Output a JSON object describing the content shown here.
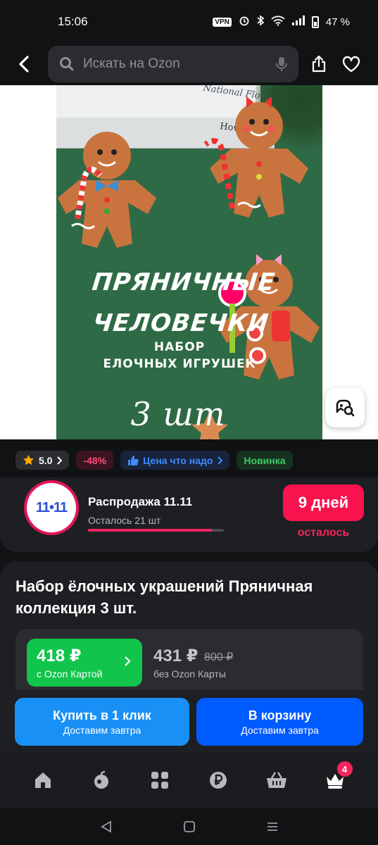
{
  "status_bar": {
    "time": "15:06",
    "vpn": "VPN",
    "battery": "47 %"
  },
  "top_bar": {
    "search_placeholder": "Искать на Ozon"
  },
  "hero_image": {
    "book_title_1": "National Flower",
    "book_title_2": "How Irelan",
    "line1": "ПРЯНИЧНЫЕ",
    "line2": "ЧЕЛОВЕЧКИ",
    "line3": "НАБОР",
    "line4": "ЕЛОЧНЫХ ИГРУШЕК",
    "line5": "3 шт"
  },
  "badges": {
    "rating": "5.0",
    "discount": "-48%",
    "price_tag": "Цена что надо",
    "new": "Новинка"
  },
  "sale": {
    "logo_text": "11•11",
    "title": "Распродажа 11.11",
    "remaining": "Осталось 21 шт",
    "progress_fraction": 0.91,
    "days_label": "9 дней",
    "days_sub": "осталось"
  },
  "product": {
    "title": "Набор ёлочных украшений Пряничная коллекция 3 шт."
  },
  "prices": {
    "ozon_card_price": "418 ₽",
    "ozon_card_label": "с Ozon Картой",
    "regular_price": "431 ₽",
    "old_price": "800 ₽",
    "regular_label": "без Ozon Карты"
  },
  "actions": {
    "buy_label": "Купить в 1 клик",
    "buy_sub": "Доставим завтра",
    "cart_label": "В корзину",
    "cart_sub": "Доставим завтра"
  },
  "bottom_nav": {
    "cart_badge": "4"
  },
  "colors": {
    "ozon_green": "#10c44c",
    "ozon_blue": "#005bff",
    "buy_blue": "#1990f5",
    "sale_pink": "#f8134f",
    "background": "#111214",
    "card": "#1e1f23"
  }
}
